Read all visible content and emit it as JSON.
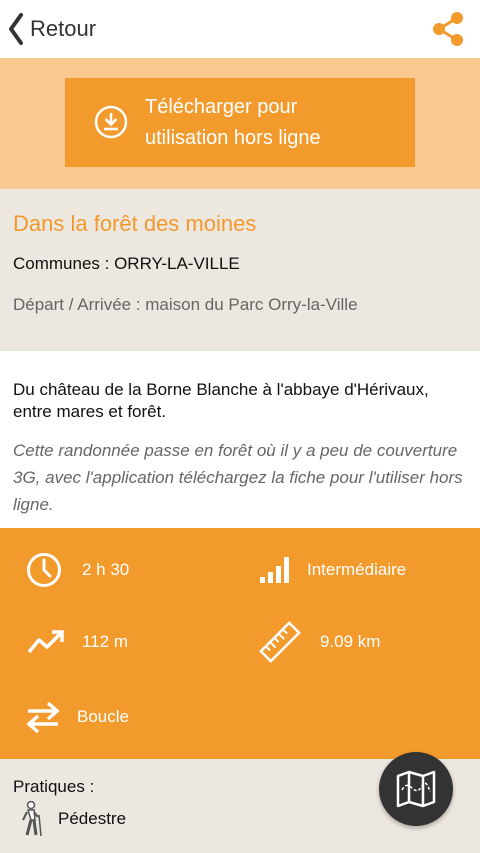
{
  "header": {
    "back_label": "Retour",
    "share_icon": "share-icon",
    "accent_color": "#f39a2d"
  },
  "download": {
    "label_line1": "Télécharger pour",
    "label_line2": "utilisation hors ligne",
    "icon": "download-icon"
  },
  "hike": {
    "title": "Dans la forêt des moines",
    "communes": "Communes : ORRY-LA-VILLE",
    "depart": "Départ / Arrivée : maison du Parc Orry-la-Ville"
  },
  "description": {
    "main": "Du château de la Borne Blanche à l'abbaye d'Hérivaux, entre mares et forêt.",
    "note": "Cette randonnée passe en forêt où il y a peu de couverture 3G, avec l'application téléchargez la fiche pour l'utiliser hors ligne."
  },
  "stats": {
    "duration": "2 h 30",
    "difficulty": "Intermédiaire",
    "elevation": "112 m",
    "distance": "9.09 km",
    "type": "Boucle"
  },
  "pratiques": {
    "title": "Pratiques :",
    "items": [
      {
        "label": "Pédestre",
        "icon": "hiker-icon"
      }
    ]
  },
  "map_button_icon": "map-icon"
}
